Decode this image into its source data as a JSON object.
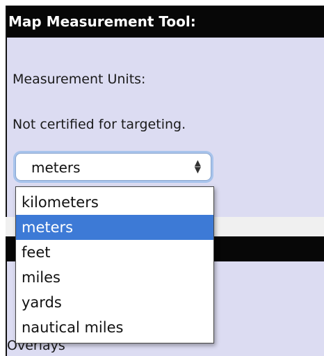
{
  "panel": {
    "title": "Map Measurement Tool:",
    "units_label": "Measurement Units:",
    "certification_note": "Not certified for targeting."
  },
  "units_select": {
    "value": "meters",
    "arrow_up": "▲",
    "arrow_down": "▼",
    "options": [
      "kilometers",
      "meters",
      "feet",
      "miles",
      "yards",
      "nautical miles"
    ],
    "selected_index": 1
  },
  "lower_panel": {
    "partial_label": "Overlays"
  },
  "colors": {
    "header_bg": "#070707",
    "panel_bg": "#dcdcf2",
    "selection": "#3d7ad6",
    "focus_ring": "#a8c4ec"
  }
}
